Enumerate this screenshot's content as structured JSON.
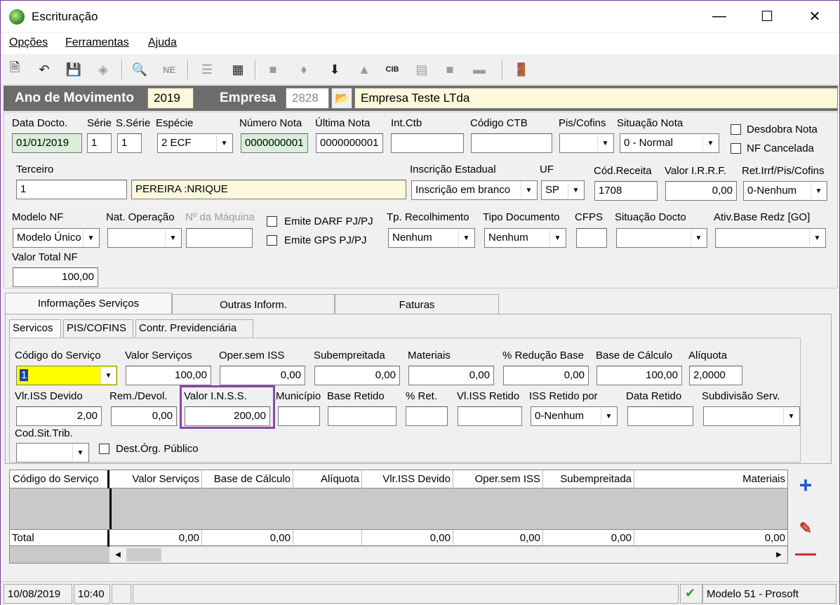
{
  "window": {
    "title": "Escrituração"
  },
  "menu": {
    "opcoes": "Opções",
    "ferramentas": "Ferramentas",
    "ajuda": "Ajuda"
  },
  "header": {
    "ano_label": "Ano de Movimento",
    "ano_value": "2019",
    "empresa_label": "Empresa",
    "empresa_code": "2828",
    "empresa_name": "Empresa Teste LTda"
  },
  "row1": {
    "data_docto_label": "Data Docto.",
    "data_docto": "01/01/2019",
    "serie_label": "Série",
    "serie": "1",
    "sserie_label": "S.Série",
    "sserie": "1",
    "especie_label": "Espécie",
    "especie": "2 ECF",
    "numero_nota_label": "Número Nota",
    "numero_nota": "0000000001",
    "ultima_nota_label": "Última Nota",
    "ultima_nota": "0000000001",
    "int_ctb_label": "Int.Ctb",
    "int_ctb": "",
    "codigo_ctb_label": "Código CTB",
    "codigo_ctb": "",
    "pis_cofins_label": "Pis/Cofins",
    "pis_cofins": "",
    "situacao_nota_label": "Situação Nota",
    "situacao_nota": "0 - Normal",
    "desdobra_nota_label": "Desdobra Nota",
    "desdobra_nota": false,
    "nf_cancelada_label": "NF Cancelada",
    "nf_cancelada": false
  },
  "row2": {
    "terceiro_label": "Terceiro",
    "terceiro_code": "1",
    "terceiro_name": "PEREIRA :NRIQUE",
    "inscricao_label": "Inscrição Estadual",
    "inscricao": "Inscrição em branco",
    "uf_label": "UF",
    "uf": "SP",
    "cod_receita_label": "Cód.Receita",
    "cod_receita": "1708",
    "valor_irrf_label": "Valor I.R.R.F.",
    "valor_irrf": "0,00",
    "ret_irrf_label": "Ret.Irrf/Pis/Cofins",
    "ret_irrf": "0-Nenhum"
  },
  "row3": {
    "modelo_nf_label": "Modelo NF",
    "modelo_nf": "Modelo Único",
    "nat_operacao_label": "Nat. Operação",
    "nat_operacao": "",
    "n_maquina_label": "Nº da Máquina",
    "n_maquina": "",
    "emite_darf_label": "Emite DARF PJ/PJ",
    "emite_gps_label": "Emite GPS PJ/PJ",
    "tp_recolhimento_label": "Tp. Recolhimento",
    "tp_recolhimento": "Nenhum",
    "tipo_documento_label": "Tipo Documento",
    "tipo_documento": "Nenhum",
    "cfps_label": "CFPS",
    "cfps": "",
    "situacao_docto_label": "Situação Docto",
    "situacao_docto": "",
    "ativ_base_label": "Ativ.Base Redz [GO]",
    "ativ_base": "",
    "valor_total_nf_label": "Valor Total NF",
    "valor_total_nf": "100,00"
  },
  "tabs": [
    "Informações Serviços",
    "Outras Inform.",
    "Faturas"
  ],
  "subtabs": [
    "Servicos",
    "PIS/COFINS",
    "Contr. Previdenciária"
  ],
  "services": {
    "codigo_servico_label": "Código do Serviço",
    "codigo_servico": "1",
    "valor_servicos_label": "Valor Serviços",
    "valor_servicos": "100,00",
    "oper_sem_iss_label": "Oper.sem ISS",
    "oper_sem_iss": "0,00",
    "subempreitada_label": "Subempreitada",
    "subempreitada": "0,00",
    "materiais_label": "Materiais",
    "materiais": "0,00",
    "reducao_base_label": "% Redução Base",
    "reducao_base": "0,00",
    "base_calculo_label": "Base de Cálculo",
    "base_calculo": "100,00",
    "aliquota_label": "Alíquota",
    "aliquota": "2,0000",
    "vlr_iss_devido_label": "Vlr.ISS Devido",
    "vlr_iss_devido": "2,00",
    "rem_devol_label": "Rem./Devol.",
    "rem_devol": "0,00",
    "valor_inss_label": "Valor I.N.S.S.",
    "valor_inss": "200,00",
    "municipio_label": "Município",
    "municipio": "",
    "base_retido_label": "Base Retido",
    "base_retido": "",
    "pct_ret_label": "% Ret.",
    "pct_ret": "",
    "vl_iss_retido_label": "Vl.ISS Retido",
    "vl_iss_retido": "",
    "iss_retido_por_label": "ISS Retido por",
    "iss_retido_por": "0-Nenhum",
    "data_retido_label": "Data Retido",
    "data_retido": "",
    "subdivisao_label": "Subdivisão Serv.",
    "subdivisao": "",
    "cod_sit_trib_label": "Cod.Sit.Trib.",
    "cod_sit_trib": "",
    "dest_org_label": "Dest.Órg. Público"
  },
  "grid": {
    "headers": [
      "Código do Serviço",
      "Valor Serviços",
      "Base de Cálculo",
      "Alíquota",
      "Vlr.ISS Devido",
      "Oper.sem ISS",
      "Subempreitada",
      "Materiais"
    ],
    "total_label": "Total",
    "totals": [
      "0,00",
      "0,00",
      "",
      "0,00",
      "0,00",
      "0,00",
      "0,00"
    ]
  },
  "status": {
    "date": "10/08/2019",
    "time": "10:40",
    "empty": "",
    "model": "Modelo 51 - Prosoft"
  },
  "colors": {
    "header_band": "#6c6c6c",
    "highlight_box": "#8e44ad",
    "green_field": "#d8f0d8",
    "yellow_field": "#fcf8dc"
  }
}
